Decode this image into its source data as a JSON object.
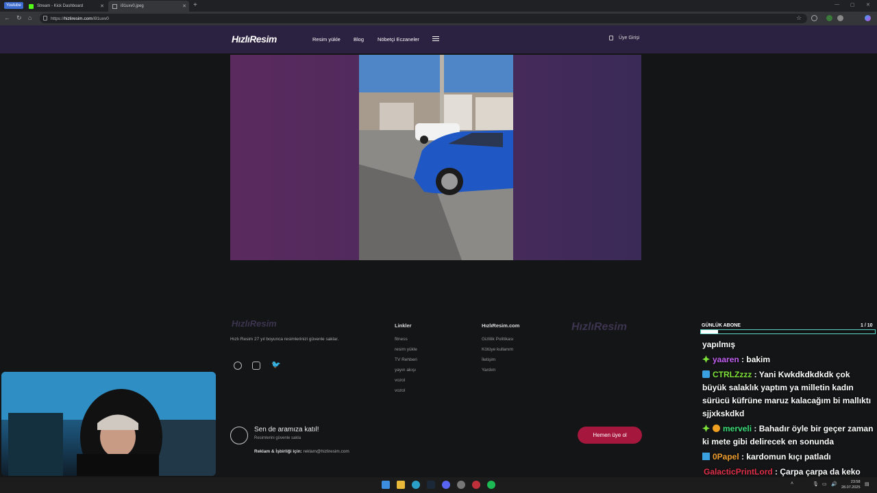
{
  "browser": {
    "youtube_badge": "Youtube",
    "tabs": [
      {
        "label": "Stream - Kick Dashboard"
      },
      {
        "label": "i91uxv0.jpeg"
      }
    ],
    "url_prefix": "https://",
    "url_domain": "hizliresim.com",
    "url_path": "/i91uxv0"
  },
  "site": {
    "logo": "HızlıResim",
    "nav": [
      "Resim yükle",
      "Blog",
      "Nöbetçi Eczaneler"
    ],
    "login": "Üye Girişi"
  },
  "footer": {
    "logo": "HızlıResim",
    "description": "Hızlı Resim 27 yıl boyunca resimlerinizi güvenle saklar.",
    "links_title": "Linkler",
    "links": [
      "fitness",
      "resim yükle",
      "TV Rehberi",
      "yayın akışı",
      "vozol",
      "vozol"
    ],
    "site_title": "HızlıResim.com",
    "site_links": [
      "Gizlilik Politikası",
      "Kötüye kullanım",
      "İletişim",
      "Yardım"
    ],
    "join_title": "Sen de aramıza katıl!",
    "join_sub": "Resimlerini güvenle sakla",
    "ads_label": "Reklam & İşbirliği için:",
    "ads_email": "reklam@hizliresim.com",
    "join_button": "Hemen üye ol"
  },
  "overlay": {
    "sub_label": "GÜNLÜK ABONE",
    "sub_count": "1 / 10",
    "sub_progress": 0.1,
    "chat": [
      {
        "user": "",
        "text": "yapılmış",
        "color": "#ffffff"
      },
      {
        "user": "yaaren",
        "text": " : bakim",
        "color": "#c160f0"
      },
      {
        "user": "CTRLZzzz",
        "text": " : Yani Kwkdkdkdkdk çok büyük salaklık yaptım ya milletin kadın sürücü küfrüne maruz kalacağım bi mallıktı sjjxkskdkd",
        "color": "#7fe23a"
      },
      {
        "user": "merveli",
        "text": " : Bahadır öyle bir geçer zaman ki mete gibi delirecek en sonunda",
        "color": "#3ce07a"
      },
      {
        "user": "0Papel",
        "text": " : kardomun kıçı patladı",
        "color": "#f0a030"
      },
      {
        "user": "GalacticPrintLord",
        "text": " : Çarpa çarpa da keko arabasına çarptım",
        "color": "#e0304a"
      }
    ]
  },
  "taskbar": {
    "time": "23:58",
    "date": "28.07.2025"
  }
}
